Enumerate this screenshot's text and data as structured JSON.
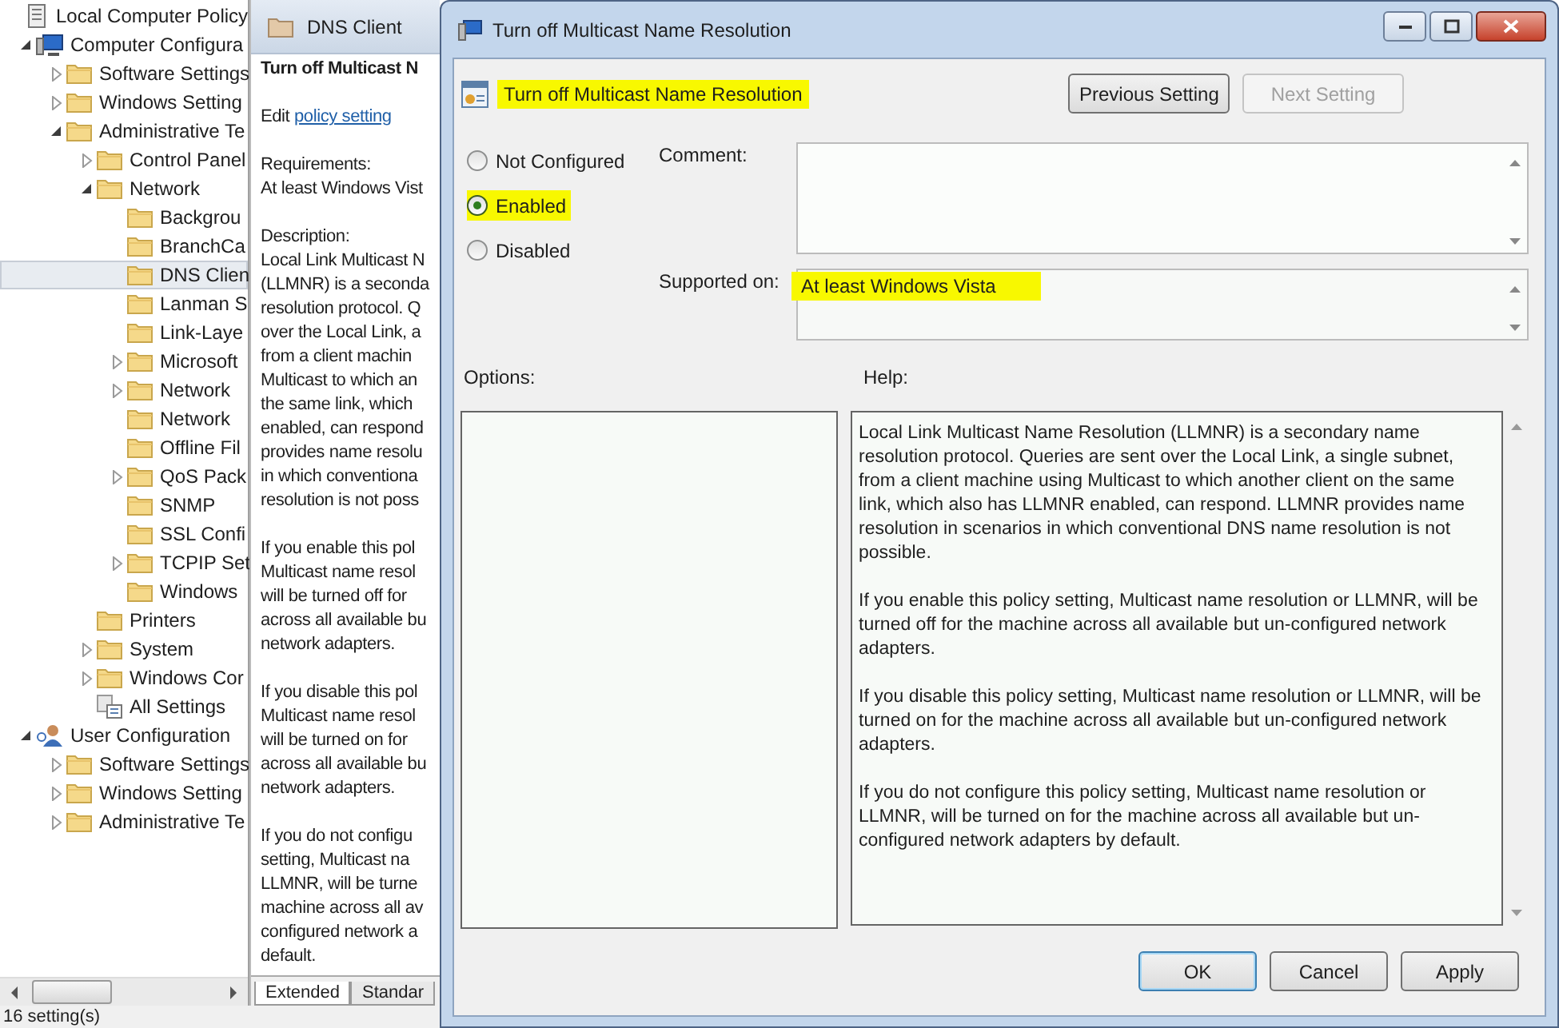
{
  "tree_pane": {
    "items": [
      {
        "label": "Local Computer Policy",
        "kind": "policy",
        "selected": false,
        "children": [
          {
            "label": "Computer Configura",
            "kind": "computer",
            "expanded": true,
            "selected": false,
            "children": [
              {
                "label": "Software Settings",
                "kind": "folder",
                "expanded": false,
                "selected": false
              },
              {
                "label": "Windows Setting",
                "kind": "folder",
                "expanded": false,
                "selected": false
              },
              {
                "label": "Administrative Te",
                "kind": "folder",
                "expanded": true,
                "selected": false,
                "children": [
                  {
                    "label": "Control Panel",
                    "kind": "folder",
                    "expanded": false,
                    "selected": false
                  },
                  {
                    "label": "Network",
                    "kind": "folder",
                    "expanded": true,
                    "selected": false,
                    "children": [
                      {
                        "label": "Backgrou",
                        "kind": "folder",
                        "selected": false
                      },
                      {
                        "label": "BranchCa",
                        "kind": "folder",
                        "selected": false
                      },
                      {
                        "label": "DNS Clien",
                        "kind": "folder",
                        "selected": true
                      },
                      {
                        "label": "Lanman S",
                        "kind": "folder",
                        "selected": false
                      },
                      {
                        "label": "Link-Laye",
                        "kind": "folder",
                        "selected": false
                      },
                      {
                        "label": "Microsoft",
                        "kind": "folder",
                        "expanded": false,
                        "selected": false
                      },
                      {
                        "label": "Network",
                        "kind": "folder",
                        "expanded": false,
                        "selected": false
                      },
                      {
                        "label": "Network",
                        "kind": "folder",
                        "selected": false
                      },
                      {
                        "label": "Offline Fil",
                        "kind": "folder",
                        "selected": false
                      },
                      {
                        "label": "QoS Pack",
                        "kind": "folder",
                        "expanded": false,
                        "selected": false
                      },
                      {
                        "label": "SNMP",
                        "kind": "folder",
                        "selected": false
                      },
                      {
                        "label": "SSL Confi",
                        "kind": "folder",
                        "selected": false
                      },
                      {
                        "label": "TCPIP Set",
                        "kind": "folder",
                        "expanded": false,
                        "selected": false
                      },
                      {
                        "label": "Windows",
                        "kind": "folder",
                        "selected": false
                      }
                    ]
                  },
                  {
                    "label": "Printers",
                    "kind": "folder",
                    "selected": false
                  },
                  {
                    "label": "System",
                    "kind": "folder",
                    "expanded": false,
                    "selected": false
                  },
                  {
                    "label": "Windows Cor",
                    "kind": "folder",
                    "expanded": false,
                    "selected": false
                  },
                  {
                    "label": "All Settings",
                    "kind": "all-settings",
                    "selected": false
                  }
                ]
              }
            ]
          },
          {
            "label": "User Configuration",
            "kind": "user",
            "expanded": true,
            "selected": false,
            "children": [
              {
                "label": "Software Settings",
                "kind": "folder",
                "expanded": false,
                "selected": false
              },
              {
                "label": "Windows Setting",
                "kind": "folder",
                "expanded": false,
                "selected": false
              },
              {
                "label": "Administrative Te",
                "kind": "folder",
                "expanded": false,
                "selected": false
              }
            ]
          }
        ]
      }
    ]
  },
  "details_pane": {
    "header": "DNS Client",
    "title": "Turn off Multicast N",
    "edit_prefix": "Edit",
    "edit_link": "policy setting",
    "requirements_label": "Requirements:",
    "requirements": "At least Windows Vist",
    "description_label": "Description:",
    "paragraphs": [
      {
        "lines": [
          "Local Link Multicast N",
          "(LLMNR) is a seconda",
          "resolution protocol. Q",
          "over the Local Link, a",
          "from a client machin",
          "Multicast to which an",
          "the same link, which",
          "enabled, can respond",
          "provides name resolu",
          "in which conventiona",
          "resolution is not poss"
        ]
      },
      {
        "lines": [
          "If you enable this pol",
          "Multicast name resol",
          "will be turned off for",
          "across all available bu",
          "network adapters."
        ]
      },
      {
        "lines": [
          "If you disable this pol",
          "Multicast name resol",
          "will be turned on for",
          "across all available bu",
          "network adapters."
        ]
      },
      {
        "lines": [
          "If you do not configu",
          "setting, Multicast na",
          "LLMNR, will be turne",
          "machine across all av",
          "configured network a",
          "default."
        ]
      }
    ],
    "tabs": [
      {
        "label": "Extended",
        "selected": true
      },
      {
        "label": "Standar",
        "selected": false
      }
    ]
  },
  "status_bar": "16 setting(s)",
  "dialog": {
    "title": "Turn off Multicast Name Resolution",
    "policy_title": {
      "text": "Turn off Multicast Name Resolution",
      "highlighted": true
    },
    "nav_buttons": [
      {
        "label": "Previous Setting",
        "disabled": false
      },
      {
        "label": "Next Setting",
        "disabled": true
      }
    ],
    "options": [
      {
        "label": "Not Configured",
        "selected": false,
        "highlighted": false
      },
      {
        "label": "Enabled",
        "selected": true,
        "highlighted": true
      },
      {
        "label": "Disabled",
        "selected": false,
        "highlighted": false
      }
    ],
    "comment_label": "Comment:",
    "supported": {
      "label": "Supported on:",
      "value": "At least Windows Vista",
      "highlighted": true
    },
    "options_label": "Options:",
    "help_label": "Help:",
    "help": [
      "Local Link Multicast Name Resolution (LLMNR) is a secondary name resolution protocol. Queries are sent over the Local Link, a single subnet, from a client machine using Multicast to which another client on the same link, which also has LLMNR enabled, can respond. LLMNR provides name resolution in scenarios in which conventional DNS name resolution is not possible.",
      "If you enable this policy setting, Multicast name resolution or LLMNR, will be turned off for the machine across all available but un-configured network adapters.",
      "If you disable this policy setting, Multicast name resolution or LLMNR, will be turned on for the machine across all available but un-configured network adapters.",
      "If you do not configure this policy setting, Multicast name resolution or LLMNR, will be turned on for the machine across all available but un-configured network adapters by default."
    ],
    "buttons": [
      {
        "label": "OK",
        "default": true
      },
      {
        "label": "Cancel",
        "default": false
      },
      {
        "label": "Apply",
        "default": false
      }
    ]
  }
}
